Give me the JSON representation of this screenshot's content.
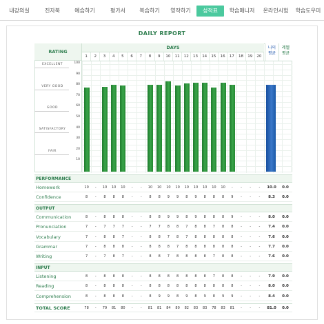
{
  "nav": {
    "tabs": [
      {
        "label": "내강의실",
        "active": false
      },
      {
        "label": "진자북",
        "active": false
      },
      {
        "label": "예습하기",
        "active": false
      },
      {
        "label": "평가서",
        "active": false
      },
      {
        "label": "복습하기",
        "active": false
      },
      {
        "label": "영작하기",
        "active": false
      },
      {
        "label": "성적표",
        "active": true
      },
      {
        "label": "학습매니저",
        "active": false
      },
      {
        "label": "온라인시험",
        "active": false
      },
      {
        "label": "학습도우미",
        "active": false
      }
    ]
  },
  "report": {
    "title": "DAILY REPORT",
    "rating_header": "RATING",
    "days_header": "DAYS",
    "my_avg_header": "나의\n평균",
    "class_avg_header": "레벨\n평균",
    "ratings": [
      "EXCELLENT",
      "VERY GOOD",
      "GOOD",
      "SATISFACTORY",
      "FAIR"
    ],
    "y_ticks": [
      "100",
      "90",
      "80",
      "70",
      "60",
      "50",
      "40",
      "30",
      "20",
      "10"
    ],
    "days": [
      "1",
      "2",
      "3",
      "4",
      "5",
      "6",
      "7",
      "8",
      "9",
      "10",
      "11",
      "12",
      "13",
      "14",
      "15",
      "16",
      "17",
      "18",
      "19",
      "20"
    ]
  },
  "chart_data": {
    "type": "bar",
    "categories": [
      "1",
      "2",
      "3",
      "4",
      "5",
      "6",
      "7",
      "8",
      "9",
      "10",
      "11",
      "12",
      "13",
      "14",
      "15",
      "16",
      "17",
      "18",
      "19",
      "20"
    ],
    "values": [
      78,
      0,
      79,
      81,
      80,
      0,
      0,
      81,
      81,
      84,
      80,
      82,
      83,
      83,
      78,
      83,
      81,
      0,
      0,
      0
    ],
    "my_average": 81,
    "class_average": 0,
    "ylim": [
      0,
      100
    ],
    "bar_color": "#2a9a3a",
    "my_average_color": "#2a6cc0"
  },
  "sections": [
    {
      "title": "PERFORMANCE",
      "rows": [
        {
          "label": "Homework",
          "values": [
            "10",
            "-",
            "10",
            "10",
            "10",
            "-",
            "-",
            "10",
            "10",
            "10",
            "10",
            "10",
            "10",
            "10",
            "10",
            "10",
            "-",
            "-",
            "-",
            "-"
          ],
          "mine": "10.0",
          "avg": "0.0"
        },
        {
          "label": "Confidence",
          "values": [
            "8",
            "-",
            "8",
            "8",
            "8",
            "-",
            "-",
            "8",
            "8",
            "9",
            "9",
            "8",
            "9",
            "8",
            "8",
            "8",
            "9",
            "-",
            "-",
            "-"
          ],
          "mine": "8.3",
          "avg": "0.0"
        }
      ]
    },
    {
      "title": "OUTPUT",
      "rows": [
        {
          "label": "Communication",
          "values": [
            "8",
            "-",
            "8",
            "8",
            "8",
            "-",
            "-",
            "8",
            "8",
            "9",
            "9",
            "8",
            "9",
            "8",
            "8",
            "8",
            "9",
            "-",
            "-",
            "-"
          ],
          "mine": "8.0",
          "avg": "0.0"
        },
        {
          "label": "Pronunciation",
          "values": [
            "7",
            "-",
            "7",
            "7",
            "7",
            "-",
            "-",
            "7",
            "7",
            "8",
            "8",
            "7",
            "8",
            "8",
            "7",
            "8",
            "8",
            "-",
            "-",
            "-"
          ],
          "mine": "7.4",
          "avg": "0.0"
        },
        {
          "label": "Vocabulary",
          "values": [
            "7",
            "-",
            "8",
            "8",
            "7",
            "-",
            "-",
            "8",
            "8",
            "7",
            "8",
            "7",
            "8",
            "8",
            "8",
            "8",
            "8",
            "-",
            "-",
            "-"
          ],
          "mine": "7.6",
          "avg": "0.0"
        },
        {
          "label": "Grammar",
          "values": [
            "7",
            "-",
            "8",
            "8",
            "8",
            "-",
            "-",
            "8",
            "8",
            "8",
            "7",
            "8",
            "8",
            "8",
            "8",
            "8",
            "8",
            "-",
            "-",
            "-"
          ],
          "mine": "7.7",
          "avg": "0.0"
        },
        {
          "label": "Writing",
          "values": [
            "7",
            "-",
            "7",
            "8",
            "7",
            "-",
            "-",
            "8",
            "8",
            "7",
            "8",
            "8",
            "8",
            "8",
            "7",
            "8",
            "8",
            "-",
            "-",
            "-"
          ],
          "mine": "7.6",
          "avg": "0.0"
        }
      ]
    },
    {
      "title": "INPUT",
      "rows": [
        {
          "label": "Listening",
          "values": [
            "8",
            "-",
            "8",
            "8",
            "8",
            "-",
            "-",
            "8",
            "8",
            "8",
            "8",
            "8",
            "8",
            "8",
            "7",
            "8",
            "8",
            "-",
            "-",
            "-"
          ],
          "mine": "7.9",
          "avg": "0.0"
        },
        {
          "label": "Reading",
          "values": [
            "8",
            "-",
            "8",
            "8",
            "8",
            "-",
            "-",
            "8",
            "8",
            "8",
            "8",
            "8",
            "8",
            "8",
            "8",
            "8",
            "8",
            "-",
            "-",
            "-"
          ],
          "mine": "8.0",
          "avg": "0.0"
        },
        {
          "label": "Comprehension",
          "values": [
            "8",
            "-",
            "8",
            "8",
            "8",
            "-",
            "-",
            "8",
            "9",
            "9",
            "8",
            "9",
            "8",
            "9",
            "8",
            "9",
            "9",
            "-",
            "-",
            "-"
          ],
          "mine": "8.4",
          "avg": "0.0"
        }
      ]
    }
  ],
  "total": {
    "label": "TOTAL SCORE",
    "values": [
      "78",
      "-",
      "79",
      "81",
      "80",
      "-",
      "-",
      "81",
      "81",
      "84",
      "80",
      "82",
      "83",
      "83",
      "78",
      "83",
      "81",
      "-",
      "-",
      "-"
    ],
    "mine": "81.0",
    "avg": "0.0"
  }
}
